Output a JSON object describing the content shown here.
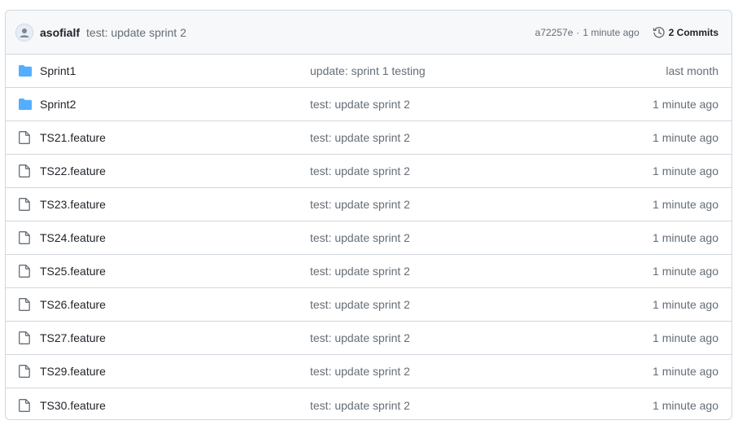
{
  "colors": {
    "border": "#d0d7de",
    "header_bg": "#f6f8fa",
    "folder": "#54aeff",
    "muted": "#656d76"
  },
  "latest_commit": {
    "avatar_icon": "user-avatar-icon",
    "author": "asofialf",
    "message": "test: update sprint 2",
    "sha": "a72257e",
    "separator": "·",
    "time": "1 minute ago",
    "history_icon": "history-icon",
    "commits_label": "2 Commits"
  },
  "files": [
    {
      "type": "folder",
      "icon": "folder-icon",
      "name": "Sprint1",
      "message": "update: sprint 1 testing",
      "age": "last month"
    },
    {
      "type": "folder",
      "icon": "folder-icon",
      "name": "Sprint2",
      "message": "test: update sprint 2",
      "age": "1 minute ago"
    },
    {
      "type": "file",
      "icon": "file-icon",
      "name": "TS21.feature",
      "message": "test: update sprint 2",
      "age": "1 minute ago"
    },
    {
      "type": "file",
      "icon": "file-icon",
      "name": "TS22.feature",
      "message": "test: update sprint 2",
      "age": "1 minute ago"
    },
    {
      "type": "file",
      "icon": "file-icon",
      "name": "TS23.feature",
      "message": "test: update sprint 2",
      "age": "1 minute ago"
    },
    {
      "type": "file",
      "icon": "file-icon",
      "name": "TS24.feature",
      "message": "test: update sprint 2",
      "age": "1 minute ago"
    },
    {
      "type": "file",
      "icon": "file-icon",
      "name": "TS25.feature",
      "message": "test: update sprint 2",
      "age": "1 minute ago"
    },
    {
      "type": "file",
      "icon": "file-icon",
      "name": "TS26.feature",
      "message": "test: update sprint 2",
      "age": "1 minute ago"
    },
    {
      "type": "file",
      "icon": "file-icon",
      "name": "TS27.feature",
      "message": "test: update sprint 2",
      "age": "1 minute ago"
    },
    {
      "type": "file",
      "icon": "file-icon",
      "name": "TS29.feature",
      "message": "test: update sprint 2",
      "age": "1 minute ago"
    },
    {
      "type": "file",
      "icon": "file-icon",
      "name": "TS30.feature",
      "message": "test: update sprint 2",
      "age": "1 minute ago"
    }
  ]
}
